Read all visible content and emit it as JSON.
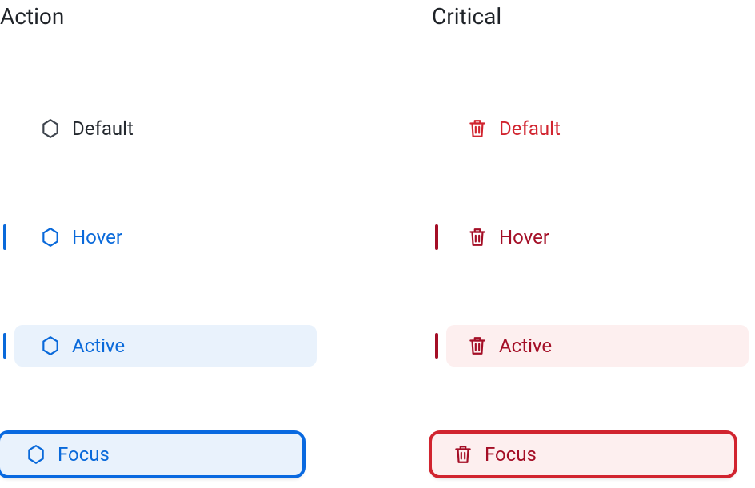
{
  "columns": {
    "action": {
      "heading": "Action",
      "icon": "hexagon",
      "states": {
        "default": "Default",
        "hover": "Hover",
        "active": "Active",
        "focus": "Focus"
      }
    },
    "critical": {
      "heading": "Critical",
      "icon": "trash",
      "states": {
        "default": "Default",
        "hover": "Hover",
        "active": "Active",
        "focus": "Focus"
      }
    }
  },
  "colors": {
    "action_text": "#0969da",
    "action_focus_ring": "#0969e0",
    "action_active_bg": "#e9f2fc",
    "critical_text": "#d1242f",
    "critical_dark": "#a40e26",
    "critical_active_bg": "#fdefef",
    "neutral_text": "#24292f"
  }
}
